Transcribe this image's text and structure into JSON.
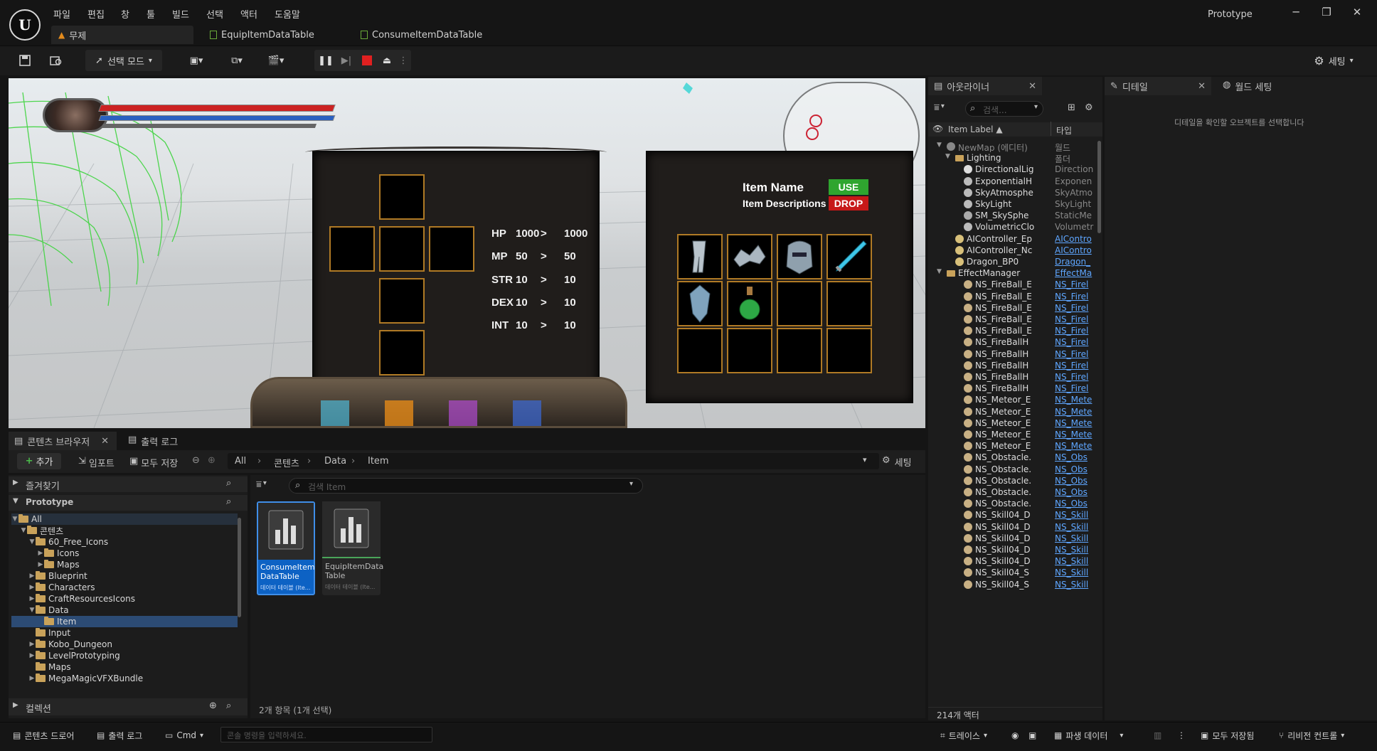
{
  "app": {
    "project": "Prototype"
  },
  "menu": [
    "파일",
    "편집",
    "창",
    "툴",
    "빌드",
    "선택",
    "액터",
    "도움말"
  ],
  "doc_tabs": [
    "무제",
    "EquipItemDataTable",
    "ConsumeItemDataTable"
  ],
  "toolbar": {
    "mode_label": "선택 모드",
    "settings_label": "세팅"
  },
  "game": {
    "stats": [
      {
        "label": "HP",
        "cur": "1000",
        "sep": ">",
        "next": "1000"
      },
      {
        "label": "MP",
        "cur": "50",
        "sep": ">",
        "next": "50"
      },
      {
        "label": "STR",
        "cur": "10",
        "sep": ">",
        "next": "10"
      },
      {
        "label": "DEX",
        "cur": "10",
        "sep": ">",
        "next": "10"
      },
      {
        "label": "INT",
        "cur": "10",
        "sep": ">",
        "next": "10"
      }
    ],
    "item_name": "Item Name",
    "item_desc": "Item Descriptions",
    "use_label": "USE",
    "drop_label": "DROP"
  },
  "content_browser": {
    "tab_label": "콘텐츠 브라우저",
    "output_tab": "출력 로그",
    "add": "추가",
    "import": "임포트",
    "save_all": "모두 저장",
    "path": [
      "All",
      "콘텐츠",
      "Data",
      "Item"
    ],
    "settings": "세팅",
    "favorites": "즐겨찾기",
    "project": "Prototype",
    "collections": "컬렉션",
    "search_placeholder": "검색 Item",
    "tree": [
      {
        "label": "All",
        "depth": 0,
        "open": true
      },
      {
        "label": "콘텐츠",
        "depth": 1,
        "open": true
      },
      {
        "label": "60_Free_Icons",
        "depth": 2,
        "open": true
      },
      {
        "label": "Icons",
        "depth": 3,
        "open": false
      },
      {
        "label": "Maps",
        "depth": 3,
        "open": false
      },
      {
        "label": "Blueprint",
        "depth": 2,
        "open": false
      },
      {
        "label": "Characters",
        "depth": 2,
        "open": false
      },
      {
        "label": "CraftResourcesIcons",
        "depth": 2,
        "open": false
      },
      {
        "label": "Data",
        "depth": 2,
        "open": true
      },
      {
        "label": "Item",
        "depth": 3,
        "open": null,
        "selected": true
      },
      {
        "label": "Input",
        "depth": 2,
        "open": null
      },
      {
        "label": "Kobo_Dungeon",
        "depth": 2,
        "open": false
      },
      {
        "label": "LevelPrototyping",
        "depth": 2,
        "open": false
      },
      {
        "label": "Maps",
        "depth": 2,
        "open": null
      },
      {
        "label": "MegaMagicVFXBundle",
        "depth": 2,
        "open": false
      }
    ],
    "assets": [
      {
        "name1": "ConsumeItem",
        "name2": "DataTable",
        "type": "데이터 테이블 (Ite...",
        "selected": true
      },
      {
        "name1": "EquipItemData",
        "name2": "Table",
        "type": "데이터 테이블 (Ite...",
        "selected": false
      }
    ],
    "count": "2개 항목 (1개 선택)"
  },
  "outliner": {
    "tab": "아웃라이너",
    "search_placeholder": "검색...",
    "col_label": "Item Label ▲",
    "col_type": "타입",
    "rows": [
      {
        "label": "NewMap (에디터)",
        "type": "월드",
        "indent": 1,
        "kind": "world",
        "arrow": "open"
      },
      {
        "label": "Lighting",
        "type": "폴더",
        "indent": 2,
        "kind": "folder",
        "arrow": "open"
      },
      {
        "label": "DirectionalLig",
        "type": "Direction",
        "indent": 3,
        "kind": "light"
      },
      {
        "label": "ExponentialH",
        "type": "Exponen",
        "indent": 3,
        "kind": "fog"
      },
      {
        "label": "SkyAtmosphe",
        "type": "SkyAtmo",
        "indent": 3,
        "kind": "sky"
      },
      {
        "label": "SkyLight",
        "type": "SkyLight",
        "indent": 3,
        "kind": "sky"
      },
      {
        "label": "SM_SkySphe",
        "type": "StaticMe",
        "indent": 3,
        "kind": "mesh"
      },
      {
        "label": "VolumetricClo",
        "type": "Volumetr",
        "indent": 3,
        "kind": "sky"
      },
      {
        "label": "AIController_Ep",
        "type": "AIContro",
        "indent": 2,
        "kind": "ai",
        "link": true
      },
      {
        "label": "AIController_Nc",
        "type": "AIContro",
        "indent": 2,
        "kind": "ai",
        "link": true
      },
      {
        "label": "Dragon_BP0",
        "type": "Dragon_",
        "indent": 2,
        "kind": "pawn",
        "link": true
      },
      {
        "label": "EffectManager",
        "type": "EffectMa",
        "indent": 1,
        "kind": "folder",
        "arrow": "open",
        "link": true
      },
      {
        "label": "NS_FireBall_E",
        "type": "NS_Firel",
        "indent": 3,
        "kind": "fx",
        "link": true
      },
      {
        "label": "NS_FireBall_E",
        "type": "NS_Firel",
        "indent": 3,
        "kind": "fx",
        "link": true
      },
      {
        "label": "NS_FireBall_E",
        "type": "NS_Firel",
        "indent": 3,
        "kind": "fx",
        "link": true
      },
      {
        "label": "NS_FireBall_E",
        "type": "NS_Firel",
        "indent": 3,
        "kind": "fx",
        "link": true
      },
      {
        "label": "NS_FireBall_E",
        "type": "NS_Firel",
        "indent": 3,
        "kind": "fx",
        "link": true
      },
      {
        "label": "NS_FireBallH",
        "type": "NS_Firel",
        "indent": 3,
        "kind": "fx",
        "link": true
      },
      {
        "label": "NS_FireBallH",
        "type": "NS_Firel",
        "indent": 3,
        "kind": "fx",
        "link": true
      },
      {
        "label": "NS_FireBallH",
        "type": "NS_Firel",
        "indent": 3,
        "kind": "fx",
        "link": true
      },
      {
        "label": "NS_FireBallH",
        "type": "NS_Firel",
        "indent": 3,
        "kind": "fx",
        "link": true
      },
      {
        "label": "NS_FireBallH",
        "type": "NS_Firel",
        "indent": 3,
        "kind": "fx",
        "link": true
      },
      {
        "label": "NS_Meteor_E",
        "type": "NS_Mete",
        "indent": 3,
        "kind": "fx",
        "link": true
      },
      {
        "label": "NS_Meteor_E",
        "type": "NS_Mete",
        "indent": 3,
        "kind": "fx",
        "link": true
      },
      {
        "label": "NS_Meteor_E",
        "type": "NS_Mete",
        "indent": 3,
        "kind": "fx",
        "link": true
      },
      {
        "label": "NS_Meteor_E",
        "type": "NS_Mete",
        "indent": 3,
        "kind": "fx",
        "link": true
      },
      {
        "label": "NS_Meteor_E",
        "type": "NS_Mete",
        "indent": 3,
        "kind": "fx",
        "link": true
      },
      {
        "label": "NS_Obstacle.",
        "type": "NS_Obs",
        "indent": 3,
        "kind": "fx",
        "link": true
      },
      {
        "label": "NS_Obstacle.",
        "type": "NS_Obs",
        "indent": 3,
        "kind": "fx",
        "link": true
      },
      {
        "label": "NS_Obstacle.",
        "type": "NS_Obs",
        "indent": 3,
        "kind": "fx",
        "link": true
      },
      {
        "label": "NS_Obstacle.",
        "type": "NS_Obs",
        "indent": 3,
        "kind": "fx",
        "link": true
      },
      {
        "label": "NS_Obstacle.",
        "type": "NS_Obs",
        "indent": 3,
        "kind": "fx",
        "link": true
      },
      {
        "label": "NS_Skill04_D",
        "type": "NS_Skill",
        "indent": 3,
        "kind": "fx",
        "link": true
      },
      {
        "label": "NS_Skill04_D",
        "type": "NS_Skill",
        "indent": 3,
        "kind": "fx",
        "link": true
      },
      {
        "label": "NS_Skill04_D",
        "type": "NS_Skill",
        "indent": 3,
        "kind": "fx",
        "link": true
      },
      {
        "label": "NS_Skill04_D",
        "type": "NS_Skill",
        "indent": 3,
        "kind": "fx",
        "link": true
      },
      {
        "label": "NS_Skill04_D",
        "type": "NS_Skill",
        "indent": 3,
        "kind": "fx",
        "link": true
      },
      {
        "label": "NS_Skill04_S",
        "type": "NS_Skill",
        "indent": 3,
        "kind": "fx",
        "link": true
      },
      {
        "label": "NS_Skill04_S",
        "type": "NS_Skill",
        "indent": 3,
        "kind": "fx",
        "link": true
      }
    ],
    "count": "214개 액터"
  },
  "details": {
    "tab": "디테일",
    "world_tab": "월드 세팅",
    "empty": "디테일을 확인할 오브젝트를 선택합니다"
  },
  "statusbar": {
    "drawer": "콘텐츠 드로어",
    "output": "출력 로그",
    "cmd": "Cmd",
    "console_placeholder": "콘솔 명령을 입력하세요.",
    "trace": "트레이스",
    "derived": "파생 데이터",
    "save_all": "모두 저장됨",
    "revision": "리비전 컨트롤"
  },
  "colors": {
    "accent": "#0070e0",
    "slot_border": "#b07a25",
    "use": "#2fa52f",
    "drop": "#c71818",
    "link": "#5ea6ff"
  }
}
